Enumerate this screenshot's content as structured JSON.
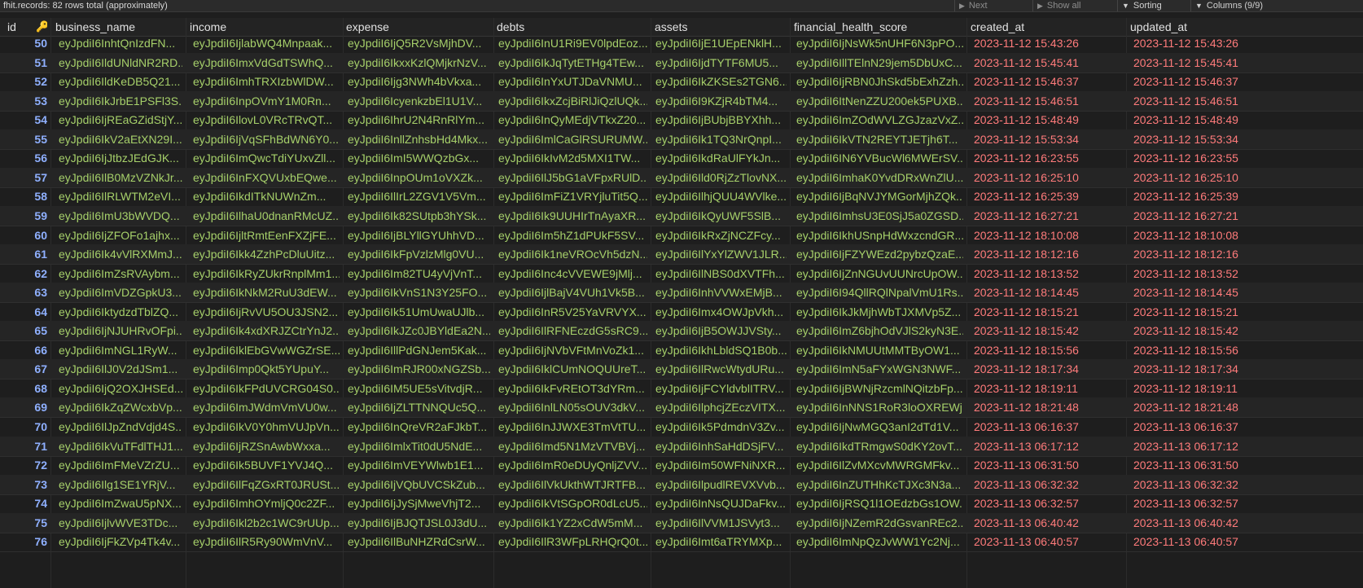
{
  "topbar": {
    "summary": "fhit.records: 82 rows total (approximately)",
    "next_label": "Next",
    "show_all_label": "Show all",
    "sorting_label": "Sorting",
    "columns_label": "Columns (9/9)"
  },
  "columns": [
    "id",
    "business_name",
    "income",
    "expense",
    "debts",
    "assets",
    "financial_health_score",
    "created_at",
    "updated_at"
  ],
  "rows": [
    {
      "id": "50",
      "business_name": "eyJpdiI6InhtQnIzdFN...",
      "income": "eyJpdiI6IjlabWQ4Mnpaak...",
      "expense": "eyJpdiI6IjQ5R2VsMjhDV...",
      "debts": "eyJpdiI6InU1Ri9EV0lpdEoz...",
      "assets": "eyJpdiI6IjE1UEpENklH...",
      "financial_health_score": "eyJpdiI6IjNsWk5nUHF6N3pPO...",
      "created_at": "2023-11-12 15:43:26",
      "updated_at": "2023-11-12 15:43:26"
    },
    {
      "id": "51",
      "business_name": "eyJpdiI6IldUNldNR2RD...",
      "income": "eyJpdiI6ImxVdGdTSWhQ...",
      "expense": "eyJpdiI6IkxxKzlQMjkrNzV...",
      "debts": "eyJpdiI6IkJqTytETHg4TEw...",
      "assets": "eyJpdiI6IjdTYTF6MU5...",
      "financial_health_score": "eyJpdiI6IllTElnN29jem5DbUxC...",
      "created_at": "2023-11-12 15:45:41",
      "updated_at": "2023-11-12 15:45:41"
    },
    {
      "id": "52",
      "business_name": "eyJpdiI6IldKeDB5Q21...",
      "income": "eyJpdiI6ImhTRXIzbWlDW...",
      "expense": "eyJpdiI6Ijg3NWh4bVkxa...",
      "debts": "eyJpdiI6InYxUTJDaVNMU...",
      "assets": "eyJpdiI6IkZKSEs2TGN6...",
      "financial_health_score": "eyJpdiI6IjRBN0JhSkd5bExhZzh...",
      "created_at": "2023-11-12 15:46:37",
      "updated_at": "2023-11-12 15:46:37"
    },
    {
      "id": "53",
      "business_name": "eyJpdiI6IkJrbE1PSFl3S...",
      "income": "eyJpdiI6InpOVmY1M0Rn...",
      "expense": "eyJpdiI6IcyenkzbEl1U1V...",
      "debts": "eyJpdiI6IkxZcjBiRlJiQzlUQk...",
      "assets": "eyJpdiI6I9KZjR4bTM4...",
      "financial_health_score": "eyJpdiI6ItNenZZU200ek5PUXB...",
      "created_at": "2023-11-12 15:46:51",
      "updated_at": "2023-11-12 15:46:51"
    },
    {
      "id": "54",
      "business_name": "eyJpdiI6IjREaGZidStjY...",
      "income": "eyJpdiI6IlovL0VRcTRvQT...",
      "expense": "eyJpdiI6IhrU2N4RnRlYm...",
      "debts": "eyJpdiI6InQyMEdjVTkxZ20...",
      "assets": "eyJpdiI6IjBUbjBBYXhh...",
      "financial_health_score": "eyJpdiI6ImZOdWVLZGJzazVxZ...",
      "created_at": "2023-11-12 15:48:49",
      "updated_at": "2023-11-12 15:48:49"
    },
    {
      "id": "55",
      "business_name": "eyJpdiI6IkV2aEtXN29I...",
      "income": "eyJpdiI6IjVqSFhBdWN6Y0...",
      "expense": "eyJpdiI6InllZnhsbHd4Mkx...",
      "debts": "eyJpdiI6ImlCaGlRSURUMW...",
      "assets": "eyJpdiI6Ik1TQ3NrQnpI...",
      "financial_health_score": "eyJpdiI6IkVTN2REYTJETjh6T...",
      "created_at": "2023-11-12 15:53:34",
      "updated_at": "2023-11-12 15:53:34"
    },
    {
      "id": "56",
      "business_name": "eyJpdiI6IjJtbzJEdGJK...",
      "income": "eyJpdiI6ImQwcTdiYUxvZll...",
      "expense": "eyJpdiI6ImI5WWQzbGx...",
      "debts": "eyJpdiI6IkIvM2d5MXI1TW...",
      "assets": "eyJpdiI6IkdRaUlFYkJn...",
      "financial_health_score": "eyJpdiI6IN6YVBucWl6MWErSV...",
      "created_at": "2023-11-12 16:23:55",
      "updated_at": "2023-11-12 16:23:55"
    },
    {
      "id": "57",
      "business_name": "eyJpdiI6IlB0MzVZNkJr...",
      "income": "eyJpdiI6InFXQVUxbEQwe...",
      "expense": "eyJpdiI6InpOUm1oVXZk...",
      "debts": "eyJpdiI6IlJ5bG1aVFpxRUlD...",
      "assets": "eyJpdiI6Ild0RjZzTlovNX...",
      "financial_health_score": "eyJpdiI6ImhaK0YvdDRxWnZlU...",
      "created_at": "2023-11-12 16:25:10",
      "updated_at": "2023-11-12 16:25:10"
    },
    {
      "id": "58",
      "business_name": "eyJpdiI6IlRLWTM2eVI...",
      "income": "eyJpdiI6IkdITkNUWnZm...",
      "expense": "eyJpdiI6IlIrL2ZGV1V5Vm...",
      "debts": "eyJpdiI6ImFiZ1VRYjluTit5Q...",
      "assets": "eyJpdiI6IlhjQUU4WVlke...",
      "financial_health_score": "eyJpdiI6IjBqNVJYMGorMjhZQk...",
      "created_at": "2023-11-12 16:25:39",
      "updated_at": "2023-11-12 16:25:39"
    },
    {
      "id": "59",
      "business_name": "eyJpdiI6ImU3bWVDQ...",
      "income": "eyJpdiI6IlhaU0dnanRMcUZ...",
      "expense": "eyJpdiI6Ik82SUtpb3hYSk...",
      "debts": "eyJpdiI6Ik9UUHIrTnAyaXR...",
      "assets": "eyJpdiI6IkQyUWF5SlB...",
      "financial_health_score": "eyJpdiI6ImhsU3E0SjJ5a0ZGSD...",
      "created_at": "2023-11-12 16:27:21",
      "updated_at": "2023-11-12 16:27:21"
    },
    {
      "id": "60",
      "business_name": "eyJpdiI6IjZFOFo1ajhx...",
      "income": "eyJpdiI6IjltRmtEenFXZjFE...",
      "expense": "eyJpdiI6IjBLYllGYUhhVD...",
      "debts": "eyJpdiI6Im5hZ1dPUkF5SV...",
      "assets": "eyJpdiI6IkRxZjNCZFcy...",
      "financial_health_score": "eyJpdiI6IkhUSnpHdWxzcndGR...",
      "created_at": "2023-11-12 18:10:08",
      "updated_at": "2023-11-12 18:10:08"
    },
    {
      "id": "61",
      "business_name": "eyJpdiI6Ik4vVlRXMmJ...",
      "income": "eyJpdiI6Ikk4ZzhPcDluUitz...",
      "expense": "eyJpdiI6IkFpVzlzMlg0VU...",
      "debts": "eyJpdiI6Ik1neVROcVh5dzN...",
      "assets": "eyJpdiI6IlYxYlZWV1JLR...",
      "financial_health_score": "eyJpdiI6IjFZYWEzd2pybzQzaE...",
      "created_at": "2023-11-12 18:12:16",
      "updated_at": "2023-11-12 18:12:16"
    },
    {
      "id": "62",
      "business_name": "eyJpdiI6ImZsRVAybm...",
      "income": "eyJpdiI6IkRyZUkrRnplMm1...",
      "expense": "eyJpdiI6Im82TU4yVjVnT...",
      "debts": "eyJpdiI6Inc4cVVEWE9jMlj...",
      "assets": "eyJpdiI6IlNBS0dXVTFh...",
      "financial_health_score": "eyJpdiI6IjZnNGUvUUNrcUpOW...",
      "created_at": "2023-11-12 18:13:52",
      "updated_at": "2023-11-12 18:13:52"
    },
    {
      "id": "63",
      "business_name": "eyJpdiI6ImVDZGpkU3...",
      "income": "eyJpdiI6IkNkM2RuU3dEW...",
      "expense": "eyJpdiI6IkVnS1N3Y25FO...",
      "debts": "eyJpdiI6IjlBajV4VUh1Vk5B...",
      "assets": "eyJpdiI6InhVVWxEMjB...",
      "financial_health_score": "eyJpdiI6I94QllRQlNpalVmU1Rs...",
      "created_at": "2023-11-12 18:14:45",
      "updated_at": "2023-11-12 18:14:45"
    },
    {
      "id": "64",
      "business_name": "eyJpdiI6IktydzdTblZQ...",
      "income": "eyJpdiI6IjRvVU5OU3JSN2...",
      "expense": "eyJpdiI6Ik51UmUwaUJlb...",
      "debts": "eyJpdiI6InR5V25YaVRVYX...",
      "assets": "eyJpdiI6Imx4OWJpVkh...",
      "financial_health_score": "eyJpdiI6IkJkMjhWbTJXMVp5Z...",
      "created_at": "2023-11-12 18:15:21",
      "updated_at": "2023-11-12 18:15:21"
    },
    {
      "id": "65",
      "business_name": "eyJpdiI6IjNJUHRvOFpi...",
      "income": "eyJpdiI6Ik4xdXRJZCtrYnJ2...",
      "expense": "eyJpdiI6IkJZc0JBYldEa2N...",
      "debts": "eyJpdiI6IlRFNEczdG5sRC9...",
      "assets": "eyJpdiI6IjB5OWJJVSty...",
      "financial_health_score": "eyJpdiI6ImZ6bjhOdVJlS2kyN3E...",
      "created_at": "2023-11-12 18:15:42",
      "updated_at": "2023-11-12 18:15:42"
    },
    {
      "id": "66",
      "business_name": "eyJpdiI6ImNGL1RyW...",
      "income": "eyJpdiI6IklEbGVwWGZrSE...",
      "expense": "eyJpdiI6IllPdGNJem5Kak...",
      "debts": "eyJpdiI6IjNVbVFtMnVoZk1...",
      "assets": "eyJpdiI6IkhLbldSQ1B0b...",
      "financial_health_score": "eyJpdiI6IkNMUUtMMTByOW1...",
      "created_at": "2023-11-12 18:15:56",
      "updated_at": "2023-11-12 18:15:56"
    },
    {
      "id": "67",
      "business_name": "eyJpdiI6IlJ0V2dJSm1...",
      "income": "eyJpdiI6Imp0Qkt5YUpuY...",
      "expense": "eyJpdiI6ImRJR00xNGZSb...",
      "debts": "eyJpdiI6IklCUmNOQUUreT...",
      "assets": "eyJpdiI6IlRwcWtydURu...",
      "financial_health_score": "eyJpdiI6ImN5aFYxWGN3NWF...",
      "created_at": "2023-11-12 18:17:34",
      "updated_at": "2023-11-12 18:17:34"
    },
    {
      "id": "68",
      "business_name": "eyJpdiI6IjQ2OXJHSEd...",
      "income": "eyJpdiI6IkFPdUVCRG04S0...",
      "expense": "eyJpdiI6IM5UE5sVitvdjR...",
      "debts": "eyJpdiI6IkFvREtOT3dYRm...",
      "assets": "eyJpdiI6IjFCYldvblITRV...",
      "financial_health_score": "eyJpdiI6IjBWNjRzcmlNQitzbFp...",
      "created_at": "2023-11-12 18:19:11",
      "updated_at": "2023-11-12 18:19:11"
    },
    {
      "id": "69",
      "business_name": "eyJpdiI6IkZqZWcxbVp...",
      "income": "eyJpdiI6ImJWdmVmVU0w...",
      "expense": "eyJpdiI6IjZLTTNNQUc5Q...",
      "debts": "eyJpdiI6InlLN05sOUV3dkV...",
      "assets": "eyJpdiI6IlphcjZEczVITX...",
      "financial_health_score": "eyJpdiI6InNNS1RoR3loOXREWj...",
      "created_at": "2023-11-12 18:21:48",
      "updated_at": "2023-11-12 18:21:48"
    },
    {
      "id": "70",
      "business_name": "eyJpdiI6IlJpZndVdjd4S...",
      "income": "eyJpdiI6IkV0Y0hmVUJpVn...",
      "expense": "eyJpdiI6InQreVR2aFJkbT...",
      "debts": "eyJpdiI6InJJWXE3TmVtTU...",
      "assets": "eyJpdiI6Ik5PdmdnV3Zv...",
      "financial_health_score": "eyJpdiI6IjNwMGQ3anI2dTd1V...",
      "created_at": "2023-11-13 06:16:37",
      "updated_at": "2023-11-13 06:16:37"
    },
    {
      "id": "71",
      "business_name": "eyJpdiI6IkVuTFdlTHJ1...",
      "income": "eyJpdiI6IjRZSnAwbWxxa...",
      "expense": "eyJpdiI6ImlxTit0dU5NdE...",
      "debts": "eyJpdiI6Imd5N1MzVTVBVj...",
      "assets": "eyJpdiI6InhSaHdDSjFV...",
      "financial_health_score": "eyJpdiI6IkdTRmgwS0dKY2ovT...",
      "created_at": "2023-11-13 06:17:12",
      "updated_at": "2023-11-13 06:17:12"
    },
    {
      "id": "72",
      "business_name": "eyJpdiI6ImFMeVZrZU...",
      "income": "eyJpdiI6Ik5BUVF1YVJ4Q...",
      "expense": "eyJpdiI6ImVEYWlwb1E1...",
      "debts": "eyJpdiI6ImR0eDUyQnljZVV...",
      "assets": "eyJpdiI6Im50WFNiNXR...",
      "financial_health_score": "eyJpdiI6IlZvMXcvMWRGMFkv...",
      "created_at": "2023-11-13 06:31:50",
      "updated_at": "2023-11-13 06:31:50"
    },
    {
      "id": "73",
      "business_name": "eyJpdiI6Ilg1SE1YRjV...",
      "income": "eyJpdiI6IlFqZGxRT0JRUSt...",
      "expense": "eyJpdiI6IjVQbUVCSkZub...",
      "debts": "eyJpdiI6IlVkUkthWTJRTFB...",
      "assets": "eyJpdiI6IlpudlREVXVvb...",
      "financial_health_score": "eyJpdiI6InZUTHhKcTJXc3N3a...",
      "created_at": "2023-11-13 06:32:32",
      "updated_at": "2023-11-13 06:32:32"
    },
    {
      "id": "74",
      "business_name": "eyJpdiI6ImZwaU5pNX...",
      "income": "eyJpdiI6ImhOYmljQ0c2ZF...",
      "expense": "eyJpdiI6IjJySjMweVhjT2...",
      "debts": "eyJpdiI6IkVtSGpOR0dLcU5...",
      "assets": "eyJpdiI6InNsQUJDaFkv...",
      "financial_health_score": "eyJpdiI6IjRSQ1l1OEdzbGs1OW...",
      "created_at": "2023-11-13 06:32:57",
      "updated_at": "2023-11-13 06:32:57"
    },
    {
      "id": "75",
      "business_name": "eyJpdiI6IjlvWVE3TDc...",
      "income": "eyJpdiI6Ikl2b2c1WC9rUUp...",
      "expense": "eyJpdiI6IjBJQTJSL0J3dU...",
      "debts": "eyJpdiI6Ik1YZ2xCdW5mM...",
      "assets": "eyJpdiI6IlVVM1JSVyt3...",
      "financial_health_score": "eyJpdiI6IjNZemR2dGsvanREc2...",
      "created_at": "2023-11-13 06:40:42",
      "updated_at": "2023-11-13 06:40:42"
    },
    {
      "id": "76",
      "business_name": "eyJpdiI6IjFkZVp4Tk4v...",
      "income": "eyJpdiI6IlR5Ry90WmVnV...",
      "expense": "eyJpdiI6IlBuNHZRdCsrW...",
      "debts": "eyJpdiI6IlR3WFpLRHQrQ0t...",
      "assets": "eyJpdiI6Imt6aTRYMXp...",
      "financial_health_score": "eyJpdiI6ImNpQzJvWW1Yc2Nj...",
      "created_at": "2023-11-13 06:40:57",
      "updated_at": "2023-11-13 06:40:57"
    }
  ],
  "colors": {
    "id": "#8fb0ff",
    "text": "#a6d06a",
    "datetime": "#ff7b7b",
    "key": "#e9b53a",
    "background": "#1e1e1e"
  },
  "icons": {
    "primary_key": "key-icon",
    "next": "triangle-right-icon",
    "show_all": "triangle-right-icon",
    "sorting": "triangle-down-icon",
    "columns": "triangle-down-icon"
  }
}
